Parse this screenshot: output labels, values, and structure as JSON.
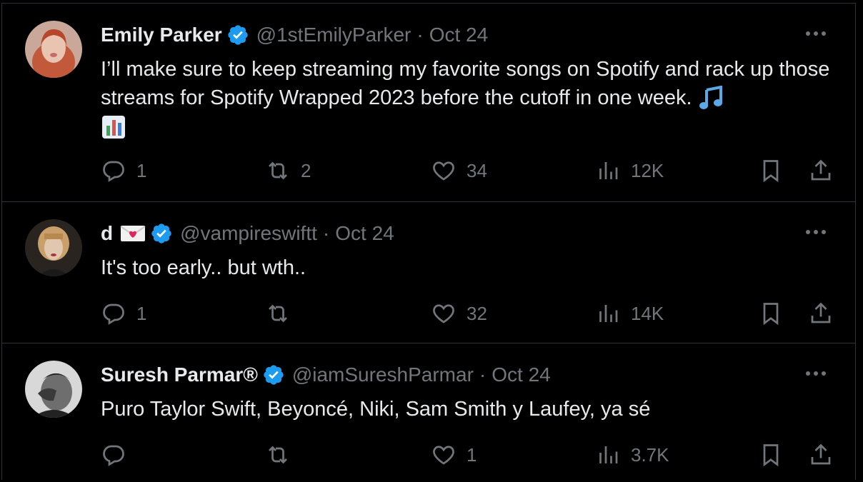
{
  "colors": {
    "background": "#000000",
    "text": "#e7e9ea",
    "muted": "#71767b",
    "verified": "#1d9bf0",
    "divider": "#2f3336"
  },
  "tweets": [
    {
      "name": "Emily Parker",
      "verified": true,
      "handle": "@1stEmilyParker",
      "separator": "·",
      "date": "Oct 24",
      "text": "I’ll make sure to keep streaming my favorite songs on Spotify and rack up those streams for Spotify Wrapped 2023 before the cutoff in one week.",
      "emojis": [
        "musical-notes-emoji",
        "bar-chart-emoji"
      ],
      "replies": "1",
      "retweets": "2",
      "likes": "34",
      "views": "12K"
    },
    {
      "name": "d",
      "name_emoji": "love-letter-emoji",
      "verified": true,
      "handle": "@vampireswiftt",
      "separator": "·",
      "date": "Oct 24",
      "text": "It's too early.. but wth..",
      "replies": "1",
      "retweets": "",
      "likes": "32",
      "views": "14K"
    },
    {
      "name": "Suresh Parmar®",
      "verified": true,
      "handle": "@iamSureshParmar",
      "separator": "·",
      "date": "Oct 24",
      "text": "Puro Taylor Swift, Beyoncé, Niki, Sam Smith y Laufey, ya sé",
      "replies": "",
      "retweets": "",
      "likes": "1",
      "views": "3.7K"
    }
  ]
}
